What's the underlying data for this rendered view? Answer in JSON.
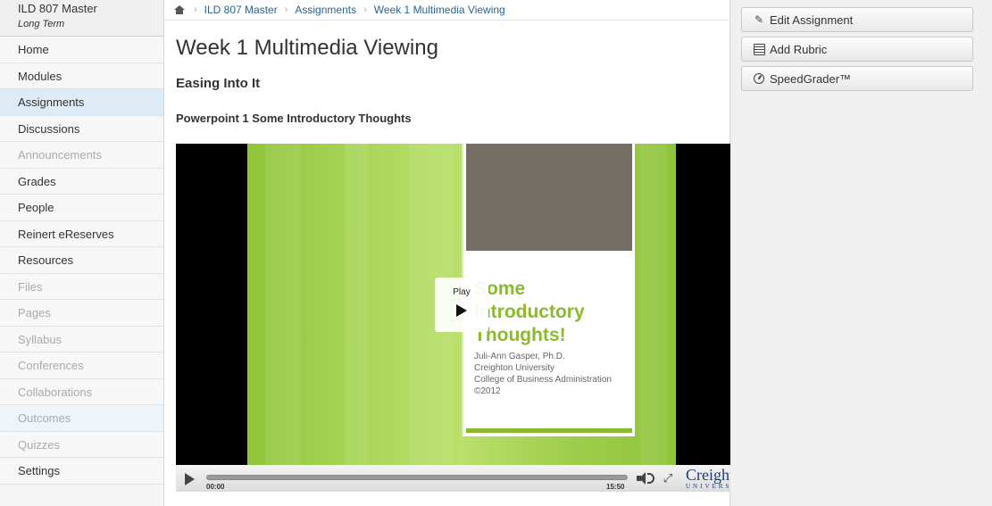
{
  "course": {
    "name": "ILD 807 Master",
    "term": "Long Term"
  },
  "nav": {
    "items": [
      {
        "label": "Home",
        "state": "normal"
      },
      {
        "label": "Modules",
        "state": "normal"
      },
      {
        "label": "Assignments",
        "state": "active"
      },
      {
        "label": "Discussions",
        "state": "normal"
      },
      {
        "label": "Announcements",
        "state": "muted"
      },
      {
        "label": "Grades",
        "state": "normal"
      },
      {
        "label": "People",
        "state": "normal"
      },
      {
        "label": "Reinert eReserves",
        "state": "normal"
      },
      {
        "label": "Resources",
        "state": "normal"
      },
      {
        "label": "Files",
        "state": "muted"
      },
      {
        "label": "Pages",
        "state": "muted"
      },
      {
        "label": "Syllabus",
        "state": "muted"
      },
      {
        "label": "Conferences",
        "state": "muted"
      },
      {
        "label": "Collaborations",
        "state": "muted"
      },
      {
        "label": "Outcomes",
        "state": "muted"
      },
      {
        "label": "Quizzes",
        "state": "muted"
      },
      {
        "label": "Settings",
        "state": "normal"
      }
    ]
  },
  "breadcrumb": [
    "ILD 807 Master",
    "Assignments",
    "Week 1 Multimedia Viewing"
  ],
  "page": {
    "title": "Week 1 Multimedia Viewing",
    "subtitle": "Easing Into It",
    "section": "Powerpoint 1 Some Introductory Thoughts"
  },
  "video": {
    "play_label": "Play",
    "current_time": "00:00",
    "duration": "15:50",
    "progress": 0,
    "slide": {
      "heading": [
        "Some",
        "Introductory",
        "Thoughts!"
      ],
      "author": "Juli-Ann Gasper, Ph.D.",
      "institution": "Creighton University",
      "college": "College of Business Administration",
      "year": "©2012"
    },
    "logo": {
      "name": "Creight",
      "sub": "UNIVERS"
    }
  },
  "actions": {
    "edit": "Edit Assignment",
    "rubric": "Add Rubric",
    "speedgrader": "SpeedGrader™"
  },
  "colors": {
    "link": "#2a6496",
    "active_nav": "#dcebf5",
    "slide_green": "#8bba2d"
  }
}
